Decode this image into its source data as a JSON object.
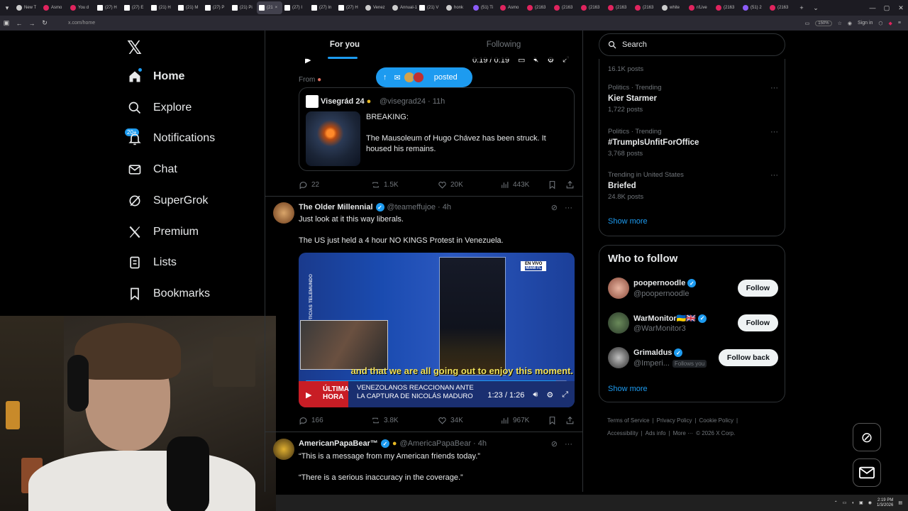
{
  "browser": {
    "tabs": [
      {
        "label": "New T",
        "fav": "w"
      },
      {
        "label": "Asmo",
        "fav": ""
      },
      {
        "label": "You d",
        "fav": ""
      },
      {
        "label": "(27) H",
        "fav": "x"
      },
      {
        "label": "(27) E",
        "fav": "x"
      },
      {
        "label": "(21) H",
        "fav": "x"
      },
      {
        "label": "(21) M",
        "fav": "x"
      },
      {
        "label": "(27) P",
        "fav": "x"
      },
      {
        "label": "(21) Pi",
        "fav": "x"
      },
      {
        "label": "(21",
        "fav": "x",
        "active": true
      },
      {
        "label": "(27) I",
        "fav": "x"
      },
      {
        "label": "(27) In",
        "fav": "x"
      },
      {
        "label": "(27) H",
        "fav": "x"
      },
      {
        "label": "Venez",
        "fav": "w"
      },
      {
        "label": "Annual-1",
        "fav": "w"
      },
      {
        "label": "(21) V",
        "fav": "x"
      },
      {
        "label": "honk",
        "fav": "w"
      },
      {
        "label": "(51) Ti",
        "fav": "p"
      },
      {
        "label": "Asmo",
        "fav": ""
      },
      {
        "label": "(2163",
        "fav": ""
      },
      {
        "label": "(2163",
        "fav": ""
      },
      {
        "label": "(2163",
        "fav": ""
      },
      {
        "label": "(2163",
        "fav": ""
      },
      {
        "label": "(2163",
        "fav": ""
      },
      {
        "label": "white",
        "fav": "w"
      },
      {
        "label": "r/Live",
        "fav": ""
      },
      {
        "label": "(2163",
        "fav": ""
      },
      {
        "label": "(51) 2",
        "fav": "p"
      },
      {
        "label": "(2163",
        "fav": ""
      }
    ],
    "url": "x.com/home",
    "zoom": "150%",
    "signin": "Sign in"
  },
  "sidebar": {
    "notif_badge": "20+",
    "items": [
      {
        "label": "Home",
        "icon": "home-icon",
        "bold": true
      },
      {
        "label": "Explore",
        "icon": "search-icon"
      },
      {
        "label": "Notifications",
        "icon": "bell-icon"
      },
      {
        "label": "Chat",
        "icon": "mail-icon"
      },
      {
        "label": "SuperGrok",
        "icon": "grok-icon"
      },
      {
        "label": "Premium",
        "icon": "x-logo-icon"
      },
      {
        "label": "Lists",
        "icon": "list-icon"
      },
      {
        "label": "Bookmarks",
        "icon": "bookmark-icon"
      }
    ]
  },
  "feed": {
    "tabs": [
      "For you",
      "Following"
    ],
    "top_video_time": "0:19 / 0:19",
    "posted_pill": "posted",
    "from_label": "From",
    "quote": {
      "name": "Visegrád 24",
      "handle": "@visegrad24 · 11h",
      "breaking": "BREAKING:",
      "text": "The Mausoleum of Hugo Chávez has been struck. It housed his remains."
    },
    "post1_actions": {
      "replies": "22",
      "reposts": "1.5K",
      "likes": "20K",
      "views": "443K"
    },
    "post2": {
      "name": "The Older Millennial",
      "handle": "@teameffujoe · 4h",
      "line1": "Just look at it this way liberals.",
      "line2": "The US just held a 4 hour NO KINGS Protest in Venezuela.",
      "video": {
        "side_text": "OTICIAS TELEMUNDO",
        "live": "EN VIVO",
        "location": "MIAMI FL",
        "caption": "and that we are all going out to enjoy this moment.",
        "ultima": "ÚLTIMA HORA",
        "headline1": "VENEZOLANOS REACCIONAN ANTE",
        "headline2": "LA CAPTURA DE NICOLÁS MADURO",
        "time": "1:23 / 1:26",
        "progress": 0.96
      },
      "actions": {
        "replies": "166",
        "reposts": "3.8K",
        "likes": "34K",
        "views": "967K"
      }
    },
    "post3": {
      "name": "AmericanPapaBear™",
      "handle": "@AmericaPapaBear · 4h",
      "line1": "“This is a message from my American friends today.”",
      "line2": "“There is a serious inaccuracy in the coverage.”"
    }
  },
  "right": {
    "search_placeholder": "Search",
    "top_count": "16.1K posts",
    "trends": [
      {
        "meta": "Politics · Trending",
        "title": "Kier Starmer",
        "count": "1,722 posts"
      },
      {
        "meta": "Politics · Trending",
        "title": "#TrumpIsUnfitForOffice",
        "count": "3,768 posts"
      },
      {
        "meta": "Trending in United States",
        "title": "Briefed",
        "count": "24.8K posts"
      }
    ],
    "show_more": "Show more",
    "who_to_follow": "Who to follow",
    "suggestions": [
      {
        "name": "poopernoodle",
        "handle": "@poopernoodle",
        "button": "Follow"
      },
      {
        "name": "WarMonitor🇺🇦🇬🇧",
        "handle": "@WarMonitor3",
        "button": "Follow"
      },
      {
        "name": "Grimaldus",
        "handle": "@Imperi...",
        "follows_you": "Follows you",
        "button": "Follow back"
      }
    ],
    "show_more2": "Show more",
    "footer_line1": [
      "Terms of Service",
      "|",
      "Privacy Policy",
      "|",
      "Cookie Policy",
      "|"
    ],
    "footer_line2": [
      "Accessibility",
      "|",
      "Ads info",
      "|",
      "More ···",
      "© 2026 X Corp."
    ]
  },
  "taskbar": {
    "time": "2:19 PM",
    "date": "1/3/2026"
  }
}
